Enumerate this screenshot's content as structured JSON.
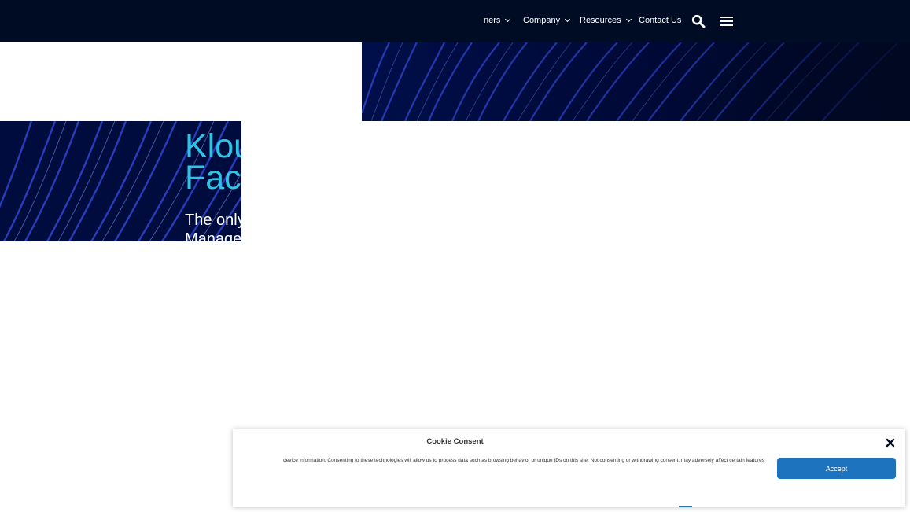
{
  "nav": {
    "items": [
      {
        "label": "ners",
        "has_dropdown": true
      },
      {
        "label": "Company",
        "has_dropdown": true
      },
      {
        "label": "Resources",
        "has_dropdown": true
      },
      {
        "label": "Contact Us",
        "has_dropdown": false
      }
    ],
    "search_icon": "search-icon",
    "menu_icon": "hamburger-menu-icon"
  },
  "hero": {
    "title": "Klou\nFace",
    "subtitle": "The only\nManage"
  },
  "cookie": {
    "title": "Cookie Consent",
    "text": "device information. Consenting to these technologies will allow us to process data such as browsing behavior or unique IDs on this site. Not consenting or withdrawing consent, may adversely affect certain features",
    "accept_label": "Accept",
    "close_icon": "close-icon"
  },
  "colors": {
    "header_bg": "#000b24",
    "title_accent": "#2bc6e6",
    "accept_button": "#1e73be"
  }
}
